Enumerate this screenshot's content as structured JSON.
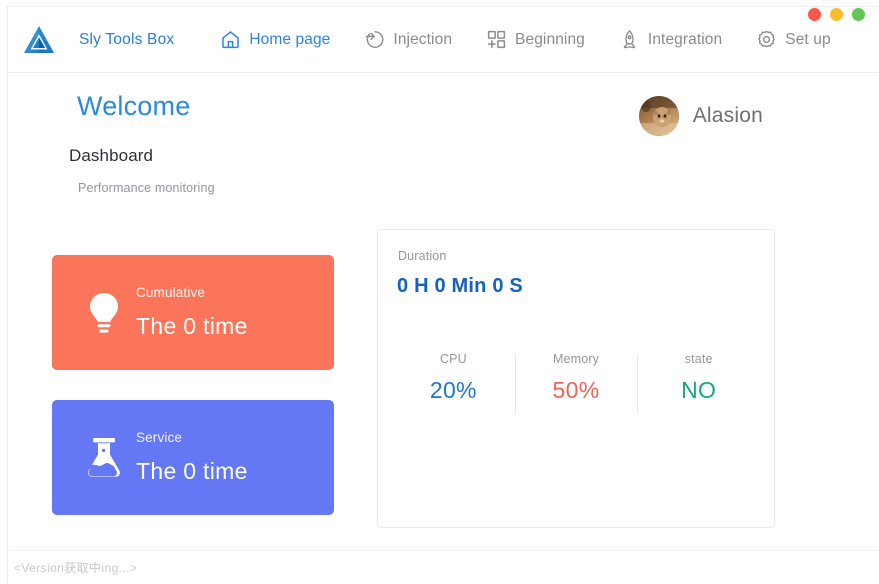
{
  "window": {
    "controls": [
      {
        "name": "close",
        "color": "#f9574b"
      },
      {
        "name": "minimize",
        "color": "#f6bd2f"
      },
      {
        "name": "maximize",
        "color": "#62c554"
      }
    ]
  },
  "brand": {
    "logo_icon": "triangle-logo-icon",
    "name": "Sly Tools Box",
    "color": "#2a7fd4"
  },
  "nav": {
    "items": [
      {
        "label": "Home page",
        "icon": "home-icon",
        "active": true
      },
      {
        "label": "Injection",
        "icon": "login-arrow-icon",
        "active": false
      },
      {
        "label": "Beginning",
        "icon": "appstore-add-icon",
        "active": false
      },
      {
        "label": "Integration",
        "icon": "rocket-icon",
        "active": false
      },
      {
        "label": "Set up",
        "icon": "gear-icon",
        "active": false
      }
    ],
    "active_color": "#2b86e0",
    "inactive_color": "#8b8b90"
  },
  "header": {
    "welcome": "Welcome",
    "dashboard_title": "Dashboard",
    "dashboard_subtitle": "Performance monitoring"
  },
  "user": {
    "name": "Alasion",
    "avatar_icon": "user-avatar-photo"
  },
  "cards": [
    {
      "label": "Cumulative",
      "value": "The 0 time",
      "icon": "lightbulb-icon",
      "color": "#fa7559"
    },
    {
      "label": "Service",
      "value": "The 0 time",
      "icon": "flask-icon",
      "color": "#6477f4"
    }
  ],
  "performance": {
    "duration_label": "Duration",
    "duration_value": "0 H 0 Min 0 S",
    "duration_color": "#1363bd",
    "metrics": [
      {
        "label": "CPU",
        "value": "20%",
        "color": "#2177c9"
      },
      {
        "label": "Memory",
        "value": "50%",
        "color": "#f0635c"
      },
      {
        "label": "state",
        "value": "NO",
        "color": "#16a97a"
      }
    ]
  },
  "status": {
    "text": "<Version获取中ing...>"
  }
}
